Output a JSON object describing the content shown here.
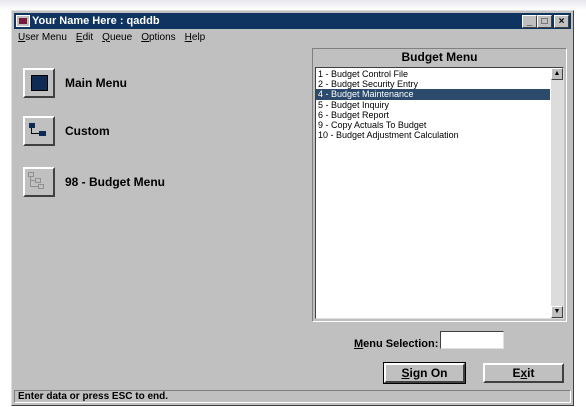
{
  "window": {
    "title": "Your Name Here : qaddb",
    "controls": {
      "minimize": "_",
      "maximize": "□",
      "close": "×"
    }
  },
  "menubar": [
    {
      "label": "User Menu",
      "mnemonic": "U",
      "rest": "ser Menu"
    },
    {
      "label": "Edit",
      "mnemonic": "E",
      "rest": "dit"
    },
    {
      "label": "Queue",
      "mnemonic": "Q",
      "rest": "ueue"
    },
    {
      "label": "Options",
      "mnemonic": "O",
      "rest": "ptions"
    },
    {
      "label": "Help",
      "mnemonic": "H",
      "rest": "elp"
    }
  ],
  "left_menu": [
    {
      "label": "Main Menu",
      "icon": "main-menu-icon"
    },
    {
      "label": "Custom",
      "icon": "custom-icon"
    },
    {
      "label": "98 - Budget Menu",
      "icon": "budget-menu-icon"
    }
  ],
  "budget_menu": {
    "title": "Budget Menu",
    "items": [
      {
        "label": "1 - Budget Control File",
        "selected": false
      },
      {
        "label": "2 - Budget Security Entry",
        "selected": false
      },
      {
        "label": "4 - Budget Maintenance",
        "selected": true
      },
      {
        "label": "5 - Budget Inquiry",
        "selected": false
      },
      {
        "label": "6 - Budget Report",
        "selected": false
      },
      {
        "label": "9 - Copy Actuals To Budget",
        "selected": false
      },
      {
        "label": "10 - Budget Adjustment Calculation",
        "selected": false
      }
    ]
  },
  "selection": {
    "label_mnemonic": "M",
    "label_rest": "enu Selection:",
    "value": ""
  },
  "buttons": {
    "sign_on": {
      "mnemonic": "S",
      "rest": "ign On"
    },
    "exit": {
      "pre": "E",
      "mnemonic": "x",
      "rest": "it"
    }
  },
  "status": "Enter data or press ESC to end.",
  "colors": {
    "titlebar": "#0f3460",
    "selection": "#2c4a6b",
    "face": "#c0c0c0"
  }
}
